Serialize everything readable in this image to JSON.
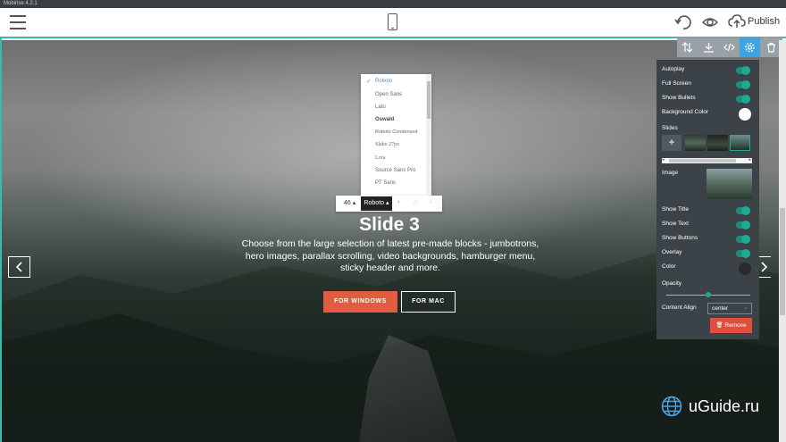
{
  "window": {
    "title": "Mobirise 4.2.1"
  },
  "topbar": {
    "menu_icon": "hamburger-icon",
    "device_icon": "phone-icon",
    "undo_icon": "undo-icon",
    "preview_icon": "eye-icon",
    "publish_icon": "cloud-upload-icon",
    "publish_label": "Publish",
    "accent_color": "#3fb8a6"
  },
  "slide": {
    "title": "Slide 3",
    "text": "Choose from the large selection of latest pre-made blocks - jumbotrons, hero images, parallax scrolling, video backgrounds, hamburger menu, sticky header and more.",
    "btn_primary": "FOR WINDOWS",
    "btn_secondary": "FOR MAC",
    "primary_color": "#e25b42"
  },
  "font_dropdown": {
    "items": [
      "Roboto",
      "Open Sans",
      "Lato",
      "Oswald",
      "Roboto Condensed",
      "Slabo 27px",
      "Lora",
      "Source Sans Pro",
      "PT Sans"
    ],
    "selected": "Roboto"
  },
  "text_toolbar": {
    "size": "46",
    "font": "Roboto"
  },
  "block_tools": {
    "icons": [
      "sort-icon",
      "download-icon",
      "code-icon",
      "gear-icon",
      "trash-icon"
    ],
    "active": "gear-icon",
    "active_color": "#3fa3e0"
  },
  "settings_panel": {
    "autoplay": "Autoplay",
    "full_screen": "Full Screen",
    "show_bullets": "Show Bullets",
    "background_color": "Background Color",
    "slides": "Slides",
    "add_slide": "+",
    "image": "Image",
    "show_title": "Show Title",
    "show_text": "Show Text",
    "show_buttons": "Show Buttons",
    "overlay": "Overlay",
    "color": "Color",
    "opacity": "Opacity",
    "opacity_value": 0.5,
    "content_align": "Content Align",
    "align_value": "center",
    "remove": "Remove",
    "toggles_on": [
      "Autoplay",
      "Full Screen",
      "Show Bullets",
      "Show Title",
      "Show Text",
      "Show Buttons",
      "Overlay"
    ],
    "bg_color": "#ffffff",
    "overlay_color": "#2a2a2a",
    "toggle_color": "#21a891"
  },
  "watermark": {
    "icon": "globe-icon",
    "text": "uGuide.ru"
  }
}
